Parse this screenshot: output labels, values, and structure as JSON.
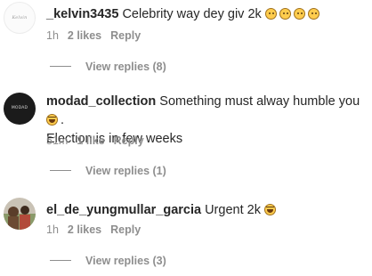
{
  "comments": [
    {
      "username": "_kelvin3435",
      "text": "Celebrity way dey giv 2k",
      "emoji": [
        "sad-face",
        "sad-face",
        "sad-face",
        "sad-face"
      ],
      "avatar_text": "Kelvin",
      "time": "1h",
      "likes": "2 likes",
      "reply": "Reply",
      "view_replies": "View replies (8)"
    },
    {
      "username": "modad_collection",
      "text": "Something must alway humble you",
      "text_after": ".",
      "text2": "Election is in few weeks",
      "emoji": [
        "laughing-face"
      ],
      "avatar_text": "MODAD",
      "time": "51m",
      "likes": "1 like",
      "reply": "Reply",
      "view_replies": "View replies (1)"
    },
    {
      "username": "el_de_yungmullar_garcia",
      "text": "Urgent 2k",
      "emoji": [
        "laughing-face"
      ],
      "time": "1h",
      "likes": "2 likes",
      "reply": "Reply",
      "view_replies": "View replies (3)"
    }
  ]
}
